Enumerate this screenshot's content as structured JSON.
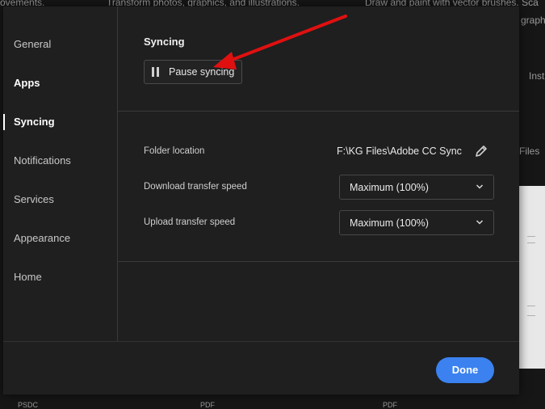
{
  "background": {
    "top_texts": [
      "ovements.",
      "Transform photos, graphics, and illustrations.",
      "Draw and paint with vector brushes. Sca",
      "graph"
    ],
    "right_texts": [
      "Inst",
      "Files"
    ],
    "bottom_texts": [
      "PSDC",
      "PDF",
      "PDF"
    ]
  },
  "sidebar": {
    "items": [
      {
        "label": "General"
      },
      {
        "label": "Apps"
      },
      {
        "label": "Syncing"
      },
      {
        "label": "Notifications"
      },
      {
        "label": "Services"
      },
      {
        "label": "Appearance"
      },
      {
        "label": "Home"
      }
    ]
  },
  "syncing": {
    "title": "Syncing",
    "pause_button_label": "Pause syncing",
    "folder_location_label": "Folder location",
    "folder_location_value": "F:\\KG Files\\Adobe CC Sync",
    "download_label": "Download transfer speed",
    "download_value": "Maximum (100%)",
    "upload_label": "Upload transfer speed",
    "upload_value": "Maximum (100%)"
  },
  "footer": {
    "done_label": "Done"
  },
  "colors": {
    "accent": "#3b82f0",
    "annotation_arrow": "#e01010"
  }
}
